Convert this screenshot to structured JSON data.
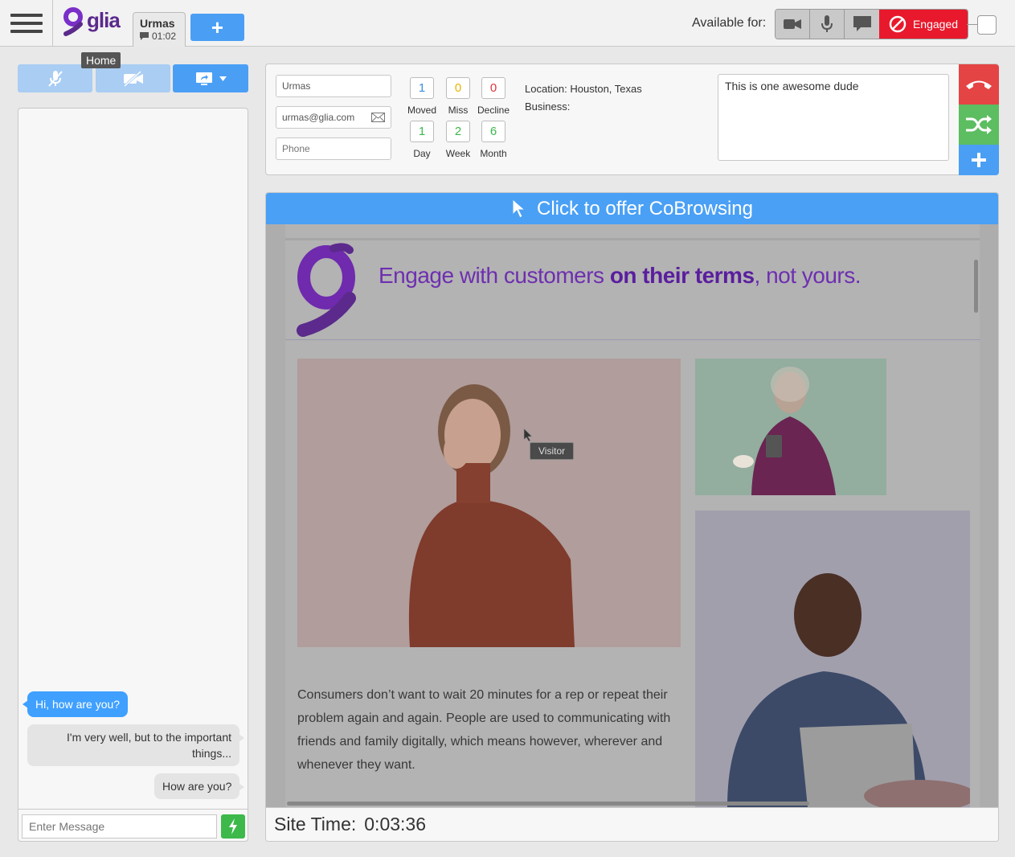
{
  "topbar": {
    "logo_text": "glia",
    "user_tab": {
      "name": "Urmas",
      "timer": "01:02"
    },
    "add_tab_label": "+",
    "available_label": "Available for:",
    "engaged_label": "Engaged",
    "colors": {
      "engaged": "#e8192c",
      "accent": "#4a9ff5"
    }
  },
  "tooltip": {
    "home": "Home"
  },
  "chat": {
    "messages": [
      {
        "from": "visitor",
        "text": "Hi, how are you?"
      },
      {
        "from": "operator",
        "text": "I'm very well, but to the important things..."
      },
      {
        "from": "operator",
        "text": "How are you?"
      }
    ],
    "input_placeholder": "Enter Message"
  },
  "visitor_info": {
    "name": "Urmas",
    "email": "urmas@glia.com",
    "phone_placeholder": "Phone",
    "stats": [
      {
        "label": "Moved",
        "value": "1",
        "color": "#3a8fe0"
      },
      {
        "label": "Miss",
        "value": "0",
        "color": "#e8b400"
      },
      {
        "label": "Decline",
        "value": "0",
        "color": "#e0333a"
      },
      {
        "label": "Day",
        "value": "1",
        "color": "#3cb94a"
      },
      {
        "label": "Week",
        "value": "2",
        "color": "#3cb94a"
      },
      {
        "label": "Month",
        "value": "6",
        "color": "#3cb94a"
      }
    ],
    "location": "Location: Houston, Texas",
    "business": "Business:",
    "notes": "This is one awesome dude"
  },
  "cobrowse": {
    "banner": "Click to offer CoBrowsing",
    "headline_part1": "Engage with customers ",
    "headline_bold1": "on their terms",
    "headline_part2": ", not yours.",
    "body": "Consumers don’t want to wait 20 minutes for a rep or repeat their problem again and again. People are used to communicating with friends and family digitally, which means however, wherever and whenever they want.",
    "visitor_label": "Visitor",
    "site_time_label": "Site Time:",
    "site_time_value": "0:03:36"
  }
}
